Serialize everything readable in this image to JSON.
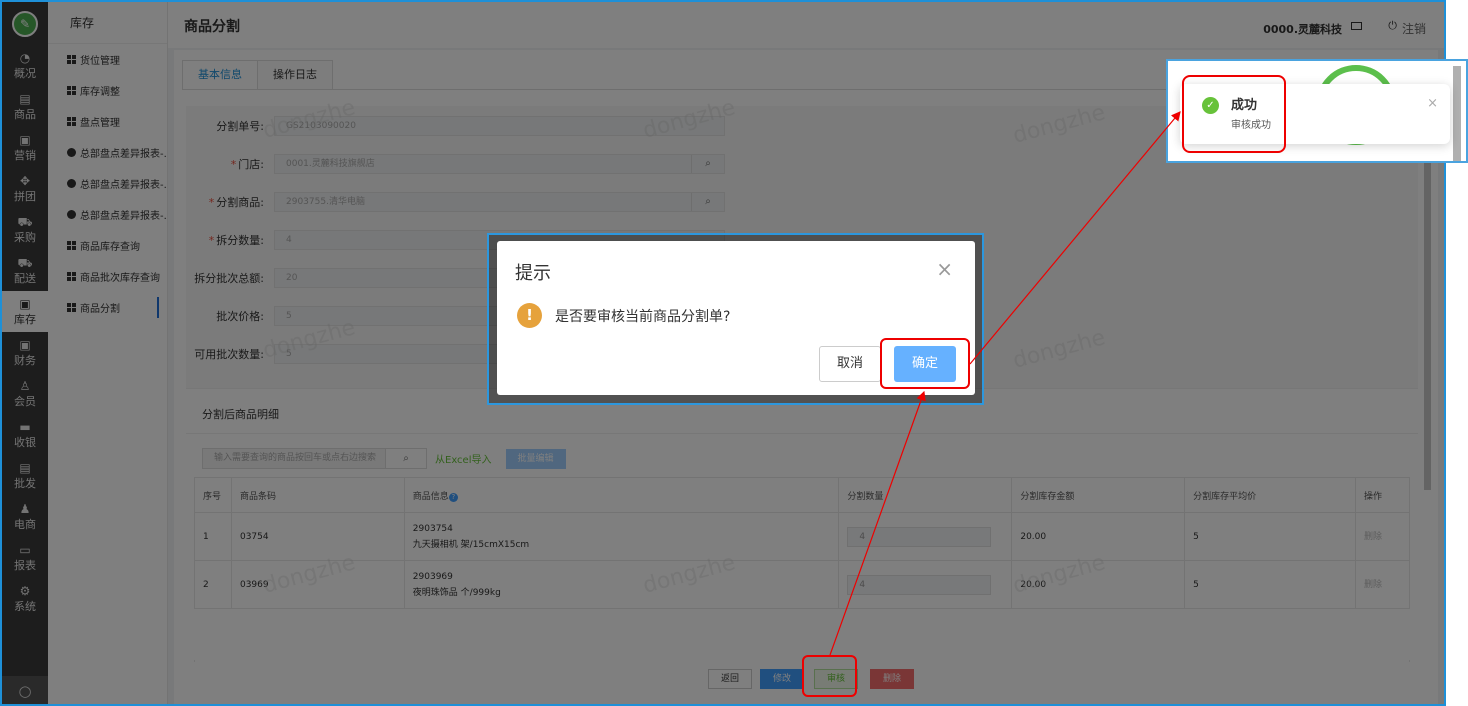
{
  "rail": {
    "items": [
      {
        "label": "概况",
        "icon": "dashboard-icon",
        "glyph": "◔"
      },
      {
        "label": "商品",
        "icon": "goods-icon",
        "glyph": "▤"
      },
      {
        "label": "营销",
        "icon": "marketing-icon",
        "glyph": "▣"
      },
      {
        "label": "拼团",
        "icon": "group-buy-icon",
        "glyph": "✥"
      },
      {
        "label": "采购",
        "icon": "cart-icon",
        "glyph": "⛟"
      },
      {
        "label": "配送",
        "icon": "truck-icon",
        "glyph": "⛟"
      },
      {
        "label": "库存",
        "icon": "box-icon",
        "glyph": "▣"
      },
      {
        "label": "财务",
        "icon": "finance-icon",
        "glyph": "▣"
      },
      {
        "label": "会员",
        "icon": "member-icon",
        "glyph": "♙"
      },
      {
        "label": "收银",
        "icon": "cashier-icon",
        "glyph": "▬"
      },
      {
        "label": "批发",
        "icon": "wholesale-icon",
        "glyph": "▤"
      },
      {
        "label": "电商",
        "icon": "ecommerce-icon",
        "glyph": "♟"
      },
      {
        "label": "报表",
        "icon": "report-icon",
        "glyph": "▭"
      },
      {
        "label": "系统",
        "icon": "settings-icon",
        "glyph": "⚙"
      }
    ]
  },
  "submenu": {
    "title": "库存",
    "items": [
      {
        "label": "货位管理",
        "type": "grid"
      },
      {
        "label": "库存调整",
        "type": "grid"
      },
      {
        "label": "盘点管理",
        "type": "grid"
      },
      {
        "label": "总部盘点差异报表-...",
        "type": "doc"
      },
      {
        "label": "总部盘点差异报表-...",
        "type": "doc"
      },
      {
        "label": "总部盘点差异报表-...",
        "type": "doc"
      },
      {
        "label": "商品库存查询",
        "type": "grid"
      },
      {
        "label": "商品批次库存查询",
        "type": "grid"
      },
      {
        "label": "商品分割",
        "type": "grid"
      }
    ]
  },
  "header": {
    "title": "商品分割",
    "company": "0000.灵麓科技",
    "logout": "注销"
  },
  "tabs": [
    "基本信息",
    "操作日志"
  ],
  "form": {
    "fields": [
      {
        "label": "分割单号:",
        "required": false,
        "value": "GS2103090020",
        "search": false
      },
      {
        "label": "门店:",
        "required": true,
        "value": "0001.灵麓科技旗舰店",
        "search": true
      },
      {
        "label": "分割商品:",
        "required": true,
        "value": "2903755.清华电脑",
        "search": true
      },
      {
        "label": "拆分数量:",
        "required": true,
        "value": "4",
        "search": false
      },
      {
        "label": "拆分批次总额:",
        "required": false,
        "value": "20",
        "search": false
      },
      {
        "label": "批次价格:",
        "required": false,
        "value": "5",
        "search": false
      },
      {
        "label": "可用批次数量:",
        "required": false,
        "value": "5",
        "search": false
      }
    ]
  },
  "detail": {
    "title": "分割后商品明细",
    "search_placeholder": "输入需要查询的商品按回车或点右边搜索",
    "excel_link": "从Excel导入",
    "bulk_edit": "批量编辑",
    "columns": [
      "序号",
      "商品条码",
      "商品信息",
      "分割数量",
      "分割库存金额",
      "分割库存平均价",
      "操作"
    ],
    "rows": [
      {
        "no": "1",
        "barcode": "03754",
        "code": "2903754",
        "name": "九天摄相机 架/15cmX15cm",
        "qty": "4",
        "amount": "20.00",
        "avg": "5",
        "op": "删除"
      },
      {
        "no": "2",
        "barcode": "03969",
        "code": "2903969",
        "name": "夜明珠饰品 个/999kg",
        "qty": "4",
        "amount": "20.00",
        "avg": "5",
        "op": "删除"
      }
    ]
  },
  "actions": {
    "back": "返回",
    "edit": "修改",
    "approve": "审核",
    "delete": "删除"
  },
  "dialog": {
    "title": "提示",
    "message": "是否要审核当前商品分割单?",
    "cancel": "取消",
    "confirm": "确定"
  },
  "notification": {
    "title": "成功",
    "message": "审核成功"
  },
  "watermark": "dongzhe",
  "colors": {
    "accent": "#409eff",
    "success": "#67c23a",
    "warning": "#e6a23c",
    "danger": "#f56c6c",
    "highlight": "#ee0000"
  }
}
